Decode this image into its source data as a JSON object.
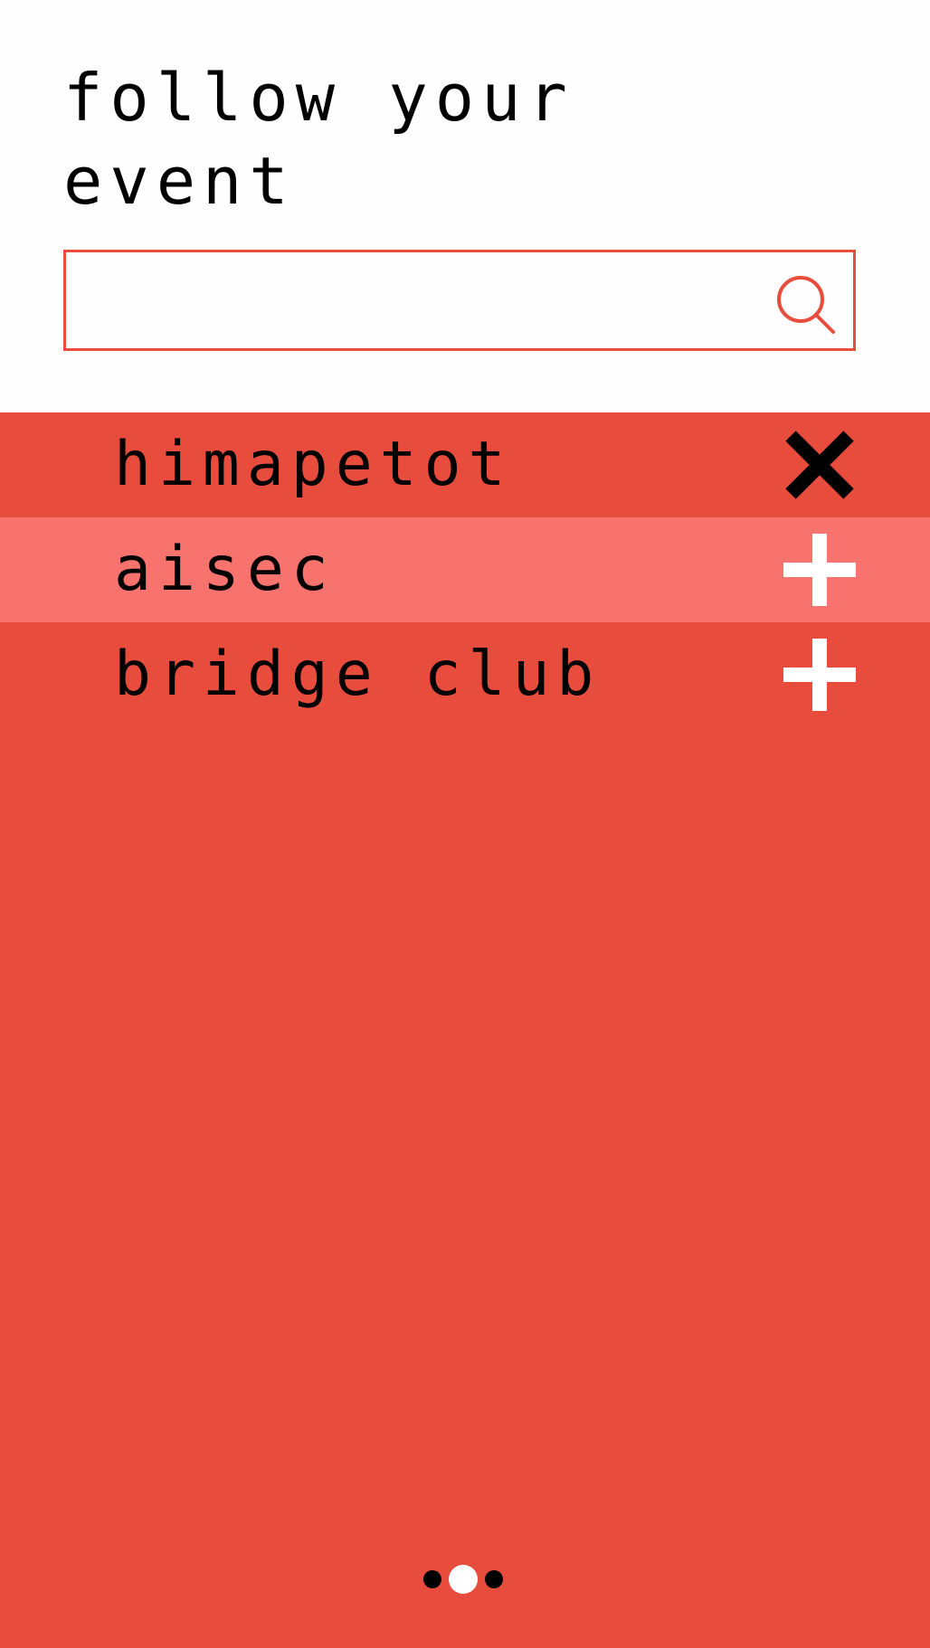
{
  "header": {
    "title": "follow your\nevent"
  },
  "search": {
    "value": "",
    "placeholder": "",
    "icon": "search-icon"
  },
  "events": [
    {
      "label": "himapetot",
      "action": "remove",
      "icon": "close-icon",
      "highlighted": false
    },
    {
      "label": "aisec",
      "action": "add",
      "icon": "plus-icon",
      "highlighted": true
    },
    {
      "label": "bridge club",
      "action": "add",
      "icon": "plus-icon",
      "highlighted": false
    }
  ],
  "pager": {
    "total": 3,
    "current": 2
  },
  "colors": {
    "accent": "#e84c3d",
    "highlight_row": "#f8726e",
    "background": "#fefefe",
    "remove_icon": "#000000",
    "add_icon": "#ffffff",
    "active_dot": "#ffffff",
    "inactive_dot": "#000000"
  }
}
